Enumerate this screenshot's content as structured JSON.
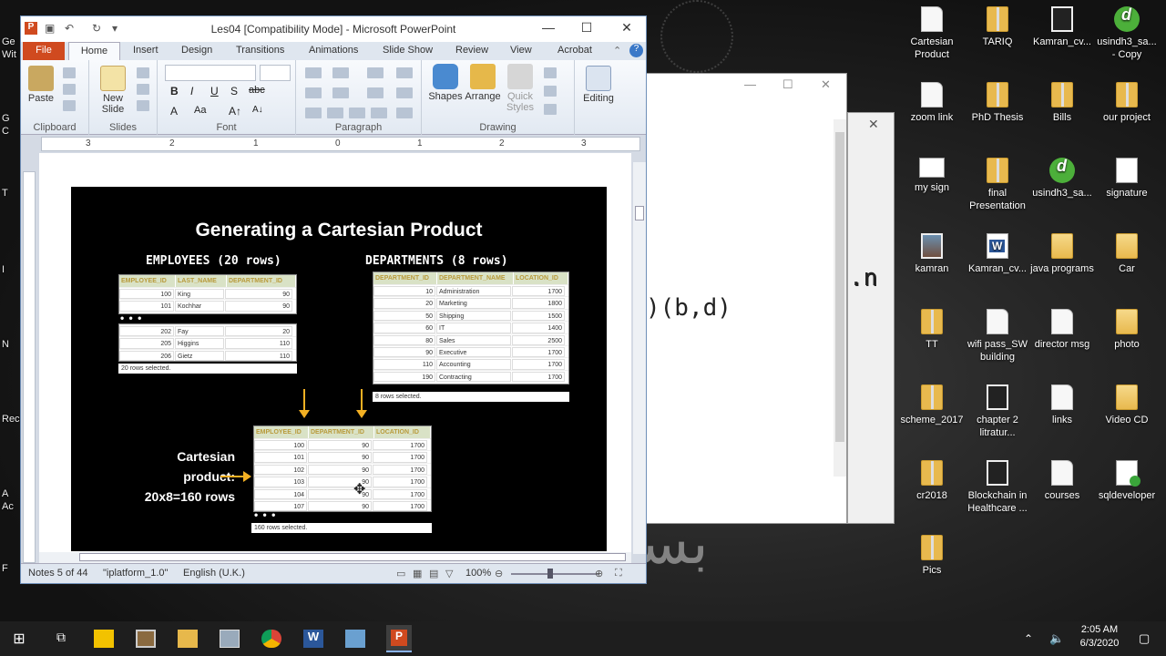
{
  "desktop": {
    "left_fragments": [
      "Ge",
      "Wit",
      "G",
      "C",
      "T",
      "I",
      "N",
      "Rec",
      "A",
      "Ac",
      "F"
    ],
    "icons": [
      {
        "label": "Cartesian Product",
        "kind": "doc"
      },
      {
        "label": "TARIQ",
        "kind": "folder zip"
      },
      {
        "label": "Kamran_cv...",
        "kind": "black"
      },
      {
        "label": "usindh3_sa... - Copy",
        "kind": "green"
      },
      {
        "label": "zoom link",
        "kind": "doc"
      },
      {
        "label": "PhD Thesis",
        "kind": "folder zip"
      },
      {
        "label": "Bills",
        "kind": "folder zip"
      },
      {
        "label": "our project",
        "kind": "folder zip"
      },
      {
        "label": "my sign",
        "kind": "wide"
      },
      {
        "label": "final Presentation",
        "kind": "folder zip"
      },
      {
        "label": "usindh3_sa...",
        "kind": "green"
      },
      {
        "label": "signature",
        "kind": "sig"
      },
      {
        "label": "kamran",
        "kind": "photo"
      },
      {
        "label": "Kamran_cv...",
        "kind": "word"
      },
      {
        "label": "java programs",
        "kind": "folder"
      },
      {
        "label": "Car",
        "kind": "folder"
      },
      {
        "label": "TT",
        "kind": "folder zip"
      },
      {
        "label": "wifi pass_SW building",
        "kind": "doc"
      },
      {
        "label": "director msg",
        "kind": "doc"
      },
      {
        "label": "photo",
        "kind": "folder"
      },
      {
        "label": "scheme_2017",
        "kind": "folder zip"
      },
      {
        "label": "chapter 2 litratur...",
        "kind": "black"
      },
      {
        "label": "links",
        "kind": "doc"
      },
      {
        "label": "Video CD",
        "kind": "folder"
      },
      {
        "label": "cr2018",
        "kind": "folder zip"
      },
      {
        "label": "Blockchain in Healthcare ...",
        "kind": "black"
      },
      {
        "label": "courses",
        "kind": "doc"
      },
      {
        "label": "sqldeveloper",
        "kind": "sqlg"
      },
      {
        "label": "Pics",
        "kind": "folder zip"
      }
    ],
    "bg_window_text_1": ".n",
    "bg_window_text_2": ")(b,d)",
    "callig": "بسم"
  },
  "ppt": {
    "title": "Les04 [Compatibility Mode]  -  Microsoft PowerPoint",
    "tabs": [
      "File",
      "Home",
      "Insert",
      "Design",
      "Transitions",
      "Animations",
      "Slide Show",
      "Review",
      "View",
      "Acrobat"
    ],
    "ribbon": {
      "paste": "Paste",
      "new_slide": "New Slide",
      "shapes": "Shapes",
      "arrange": "Arrange",
      "quick_styles": "Quick Styles",
      "editing": "Editing",
      "groups": [
        "Clipboard",
        "Slides",
        "Font",
        "Paragraph",
        "Drawing"
      ]
    },
    "ruler_marks": [
      "3",
      "2",
      "1",
      "0",
      "1",
      "2",
      "3"
    ],
    "status": {
      "notes": "Notes 5 of 44",
      "theme": "\"iplatform_1.0\"",
      "lang": "English (U.K.)",
      "zoom": "100%"
    }
  },
  "slide": {
    "title": "Generating a Cartesian Product",
    "employees_head": "EMPLOYEES  (20 rows)",
    "departments_head": "DEPARTMENTS  (8 rows)",
    "emp_cols": [
      "EMPLOYEE_ID",
      "LAST_NAME",
      "DEPARTMENT_ID"
    ],
    "emp_rows_top": [
      [
        "100",
        "King",
        "90"
      ],
      [
        "101",
        "Kochhar",
        "90"
      ]
    ],
    "emp_rows_bottom": [
      [
        "202",
        "Fay",
        "20"
      ],
      [
        "205",
        "Higgins",
        "110"
      ],
      [
        "206",
        "Gietz",
        "110"
      ]
    ],
    "emp_footer": "20 rows selected.",
    "dept_cols": [
      "DEPARTMENT_ID",
      "DEPARTMENT_NAME",
      "LOCATION_ID"
    ],
    "dept_rows": [
      [
        "10",
        "Administration",
        "1700"
      ],
      [
        "20",
        "Marketing",
        "1800"
      ],
      [
        "50",
        "Shipping",
        "1500"
      ],
      [
        "60",
        "IT",
        "1400"
      ],
      [
        "80",
        "Sales",
        "2500"
      ],
      [
        "90",
        "Executive",
        "1700"
      ],
      [
        "110",
        "Accounting",
        "1700"
      ],
      [
        "190",
        "Contracting",
        "1700"
      ]
    ],
    "dept_footer": "8 rows selected.",
    "cart_cols": [
      "EMPLOYEE_ID",
      "DEPARTMENT_ID",
      "LOCATION_ID"
    ],
    "cart_rows": [
      [
        "100",
        "90",
        "1700"
      ],
      [
        "101",
        "90",
        "1700"
      ],
      [
        "102",
        "90",
        "1700"
      ],
      [
        "103",
        "90",
        "1700"
      ],
      [
        "104",
        "90",
        "1700"
      ],
      [
        "107",
        "90",
        "1700"
      ]
    ],
    "cart_footer": "160 rows selected.",
    "dots": "• • •",
    "cp_line1": "Cartesian",
    "cp_line2": "product:",
    "cp_line3": "20x8=160  rows"
  },
  "tray": {
    "time": "2:05 AM",
    "date": "6/3/2020"
  }
}
